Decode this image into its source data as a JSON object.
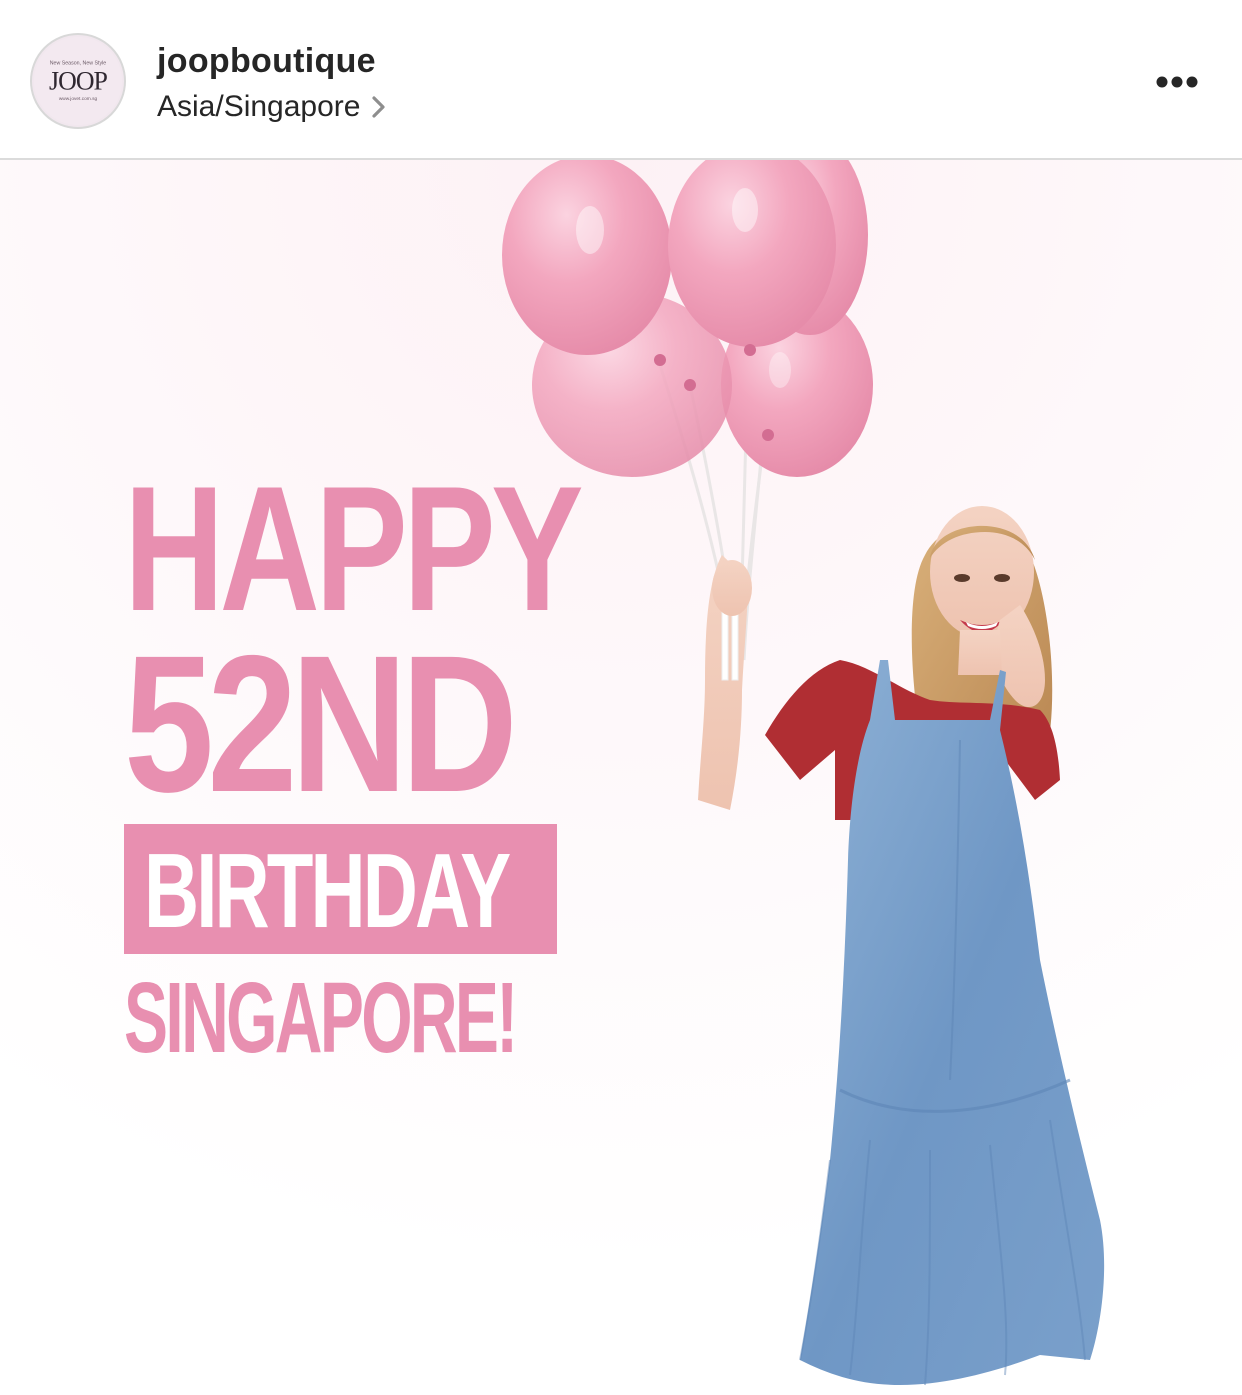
{
  "post_header": {
    "avatar": {
      "tagline": "New Season, New Style",
      "brand": "JOOP",
      "website": "www.jovet.com.sg"
    },
    "username": "joopboutique",
    "location": "Asia/Singapore",
    "location_icon": "chevron-right-icon",
    "more_icon": "more-horizontal-icon"
  },
  "post_image": {
    "headline_line1": "HAPPY",
    "headline_line2": "52ND",
    "headline_line3": "BIRTHDAY",
    "headline_line4": "SINGAPORE!",
    "accent_color": "#e88fb0",
    "balloon_color": "#f2a9c0"
  }
}
